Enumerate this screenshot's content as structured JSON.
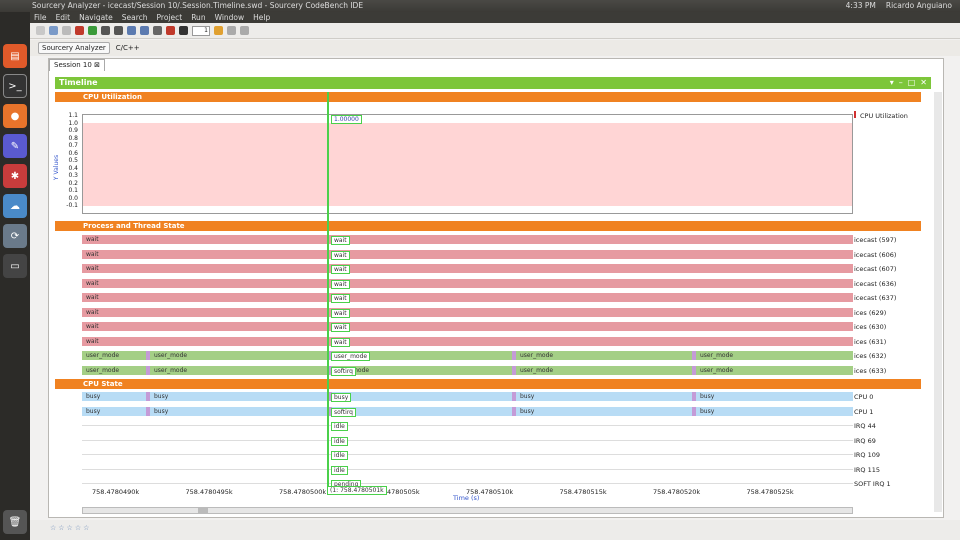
{
  "os": {
    "window_title": "Sourcery Analyzer - icecast/Session 10/.Session.Timeline.swd - Sourcery CodeBench IDE",
    "time": "4:33 PM",
    "user": "Ricardo Anguiano"
  },
  "menu": [
    "File",
    "Edit",
    "Navigate",
    "Search",
    "Project",
    "Run",
    "Window",
    "Help"
  ],
  "toolbar": {
    "counter": "1"
  },
  "perspectives": [
    "Sourcery Analyzer",
    "C/C++"
  ],
  "editor_tab": "Session 10",
  "timeline": {
    "title": "Timeline"
  },
  "cpu_util": {
    "section_title": "CPU Utilization",
    "ylabel": "Y Values",
    "yticks": [
      "1.1",
      "1.0",
      "0.9",
      "0.8",
      "0.7",
      "0.6",
      "0.5",
      "0.4",
      "0.3",
      "0.2",
      "0.1",
      "0.0",
      "-0.1"
    ],
    "cursor_value": "1.00000",
    "legend": "CPU Utilization",
    "fill_color": "#ffd5d5"
  },
  "process": {
    "section_title": "Process and Thread State",
    "rows": [
      {
        "label": "icecast (597)",
        "state": "wait",
        "tag": "wait"
      },
      {
        "label": "icecast (606)",
        "state": "wait",
        "tag": "wait"
      },
      {
        "label": "icecast (607)",
        "state": "wait",
        "tag": "wait"
      },
      {
        "label": "icecast (636)",
        "state": "wait",
        "tag": "wait"
      },
      {
        "label": "icecast (637)",
        "state": "wait",
        "tag": "wait"
      },
      {
        "label": "ices (629)",
        "state": "wait",
        "tag": "wait"
      },
      {
        "label": "ices (630)",
        "state": "wait",
        "tag": "wait"
      },
      {
        "label": "ices (631)",
        "state": "wait",
        "tag": "wait"
      },
      {
        "label": "ices (632)",
        "state": "user_mode",
        "tag": "user_mode",
        "segs": [
          "user_mode",
          "user_mode",
          "user_mode",
          "user_mode",
          "user_mode"
        ]
      },
      {
        "label": "ices (633)",
        "state": "user_mode",
        "tag": "softirq",
        "tag2": "mode",
        "segs": [
          "user_mode",
          "user_mode",
          "user_mode",
          "user_mode",
          "user_mode"
        ]
      }
    ]
  },
  "cpu_state": {
    "section_title": "CPU State",
    "rows": [
      {
        "label": "CPU 0",
        "tag": "busy",
        "segs": [
          "busy",
          "busy",
          "busy",
          "busy",
          "busy"
        ]
      },
      {
        "label": "CPU 1",
        "tag": "softirq",
        "segs": [
          "busy",
          "busy",
          "busy",
          "busy",
          "busy"
        ]
      },
      {
        "label": "IRQ 44",
        "tag": "idle"
      },
      {
        "label": "IRQ 69",
        "tag": "idle"
      },
      {
        "label": "IRQ 109",
        "tag": "idle"
      },
      {
        "label": "IRQ 115",
        "tag": "idle"
      },
      {
        "label": "SOFT IRQ 1",
        "tag": "pending"
      }
    ]
  },
  "axis": {
    "ticks": [
      "758.4780490k",
      "758.4780495k",
      "758.4780500k",
      "758.4780505k",
      "758.4780510k",
      "758.4780515k",
      "758.4780520k",
      "758.4780525k"
    ],
    "cursor_label": "(1: 758.4780501k",
    "xlabel": "Time (s)"
  }
}
